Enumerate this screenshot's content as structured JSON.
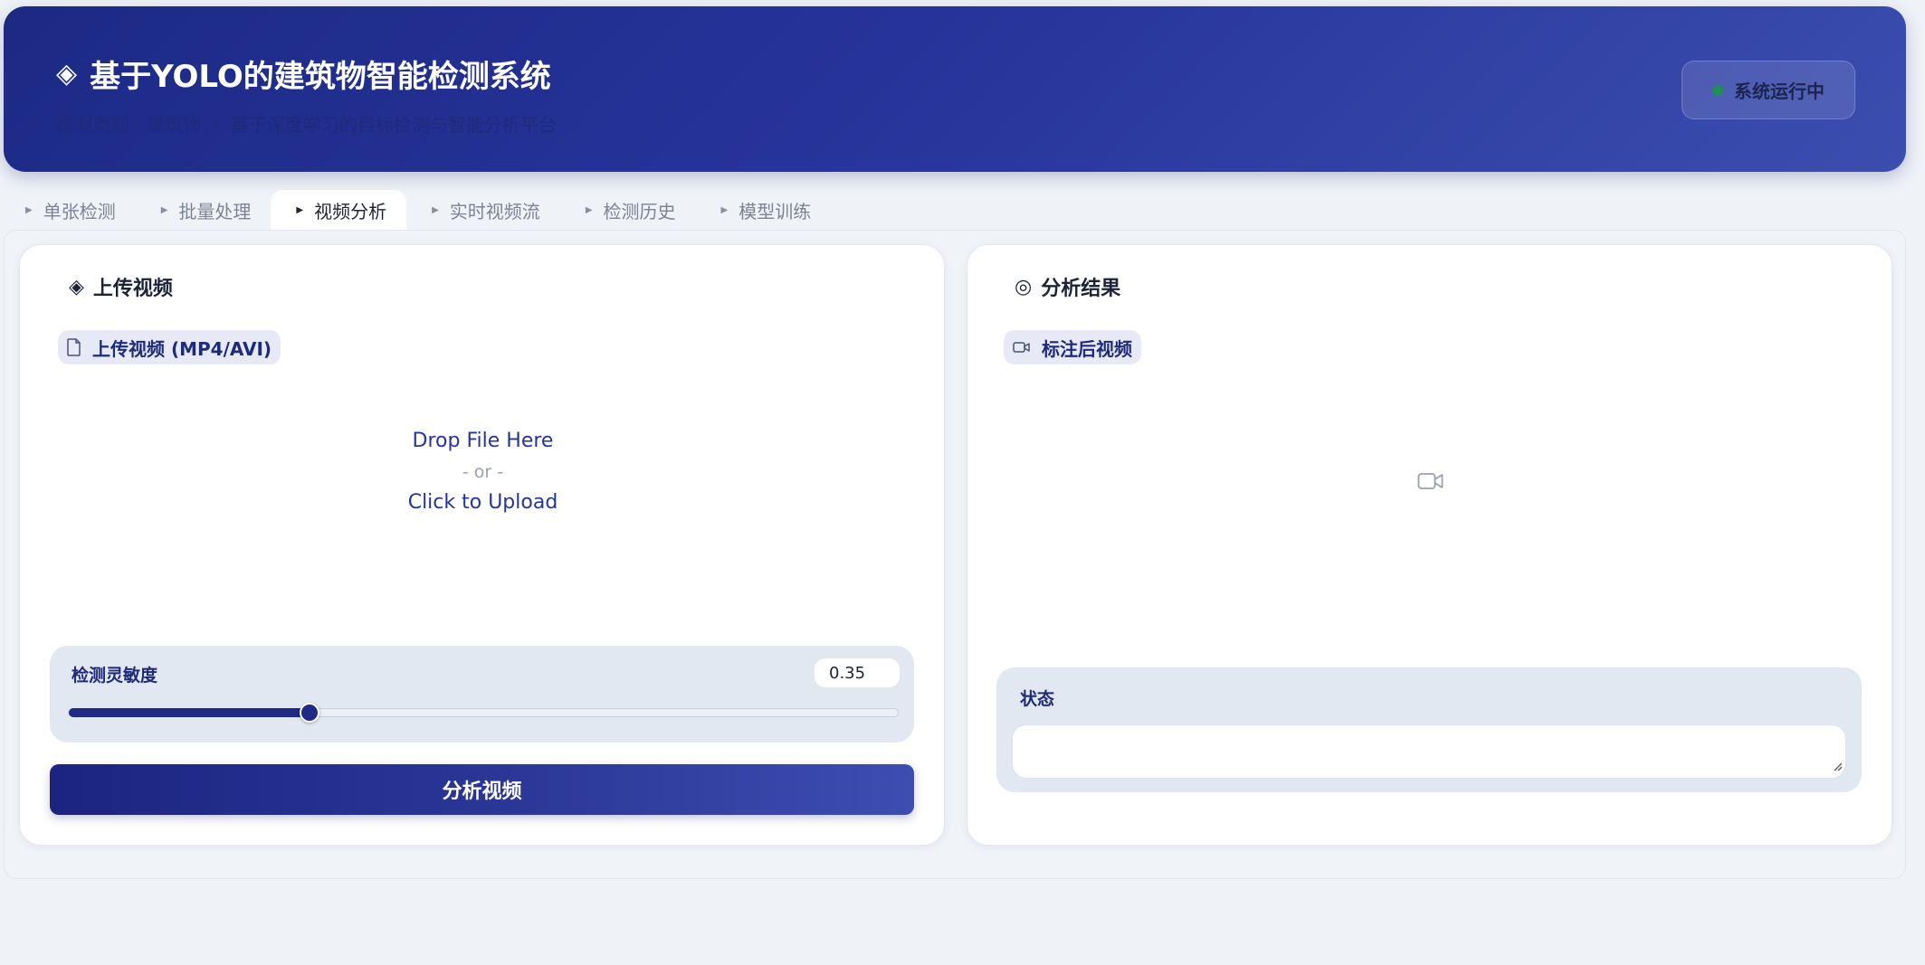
{
  "header": {
    "title": "基于YOLO的建筑物智能检测系统",
    "subtitle": "检测类别：建筑物 ｜ 基于深度学习的目标检测与智能分析平台",
    "status": "系统运行中",
    "status_color": "#1f8f55",
    "title_icon": "diamond-icon"
  },
  "tabs": [
    {
      "label": "单张检测",
      "active": false
    },
    {
      "label": "批量处理",
      "active": false
    },
    {
      "label": "视频分析",
      "active": true
    },
    {
      "label": "实时视频流",
      "active": false
    },
    {
      "label": "检测历史",
      "active": false
    },
    {
      "label": "模型训练",
      "active": false
    }
  ],
  "left_panel": {
    "heading": "上传视频",
    "heading_icon": "diamond-icon",
    "upload_chip": "上传视频 (MP4/AVI)",
    "upload_chip_icon": "file-icon",
    "dropzone": {
      "line1": "Drop File Here",
      "line2": "- or -",
      "line3": "Click to Upload"
    },
    "slider": {
      "label": "检测灵敏度",
      "value": "0.35",
      "fraction": 0.29
    },
    "action_button": "分析视频"
  },
  "right_panel": {
    "heading": "分析结果",
    "heading_icon": "target-icon",
    "video_chip": "标注后视频",
    "video_chip_icon": "video-camera-icon",
    "placeholder_icon": "video-camera-icon",
    "state_label": "状态",
    "state_value": ""
  },
  "colors": {
    "accent": "#1e2a85",
    "header_gradient_start": "#1c2a85",
    "header_gradient_end": "#3b4eae",
    "page_background": "#eff2f7"
  }
}
